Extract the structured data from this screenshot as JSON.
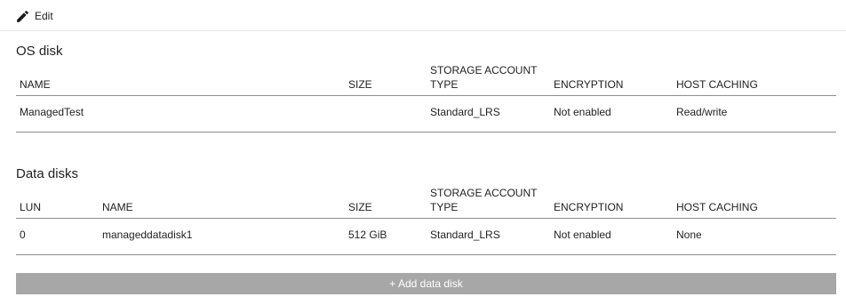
{
  "toolbar": {
    "edit_label": "Edit",
    "edit_icon": "pencil-icon"
  },
  "os_disk": {
    "title": "OS disk",
    "columns": {
      "name": "NAME",
      "size": "SIZE",
      "storage_line1": "STORAGE ACCOUNT",
      "storage_line2": "TYPE",
      "encryption": "ENCRYPTION",
      "host_caching": "HOST CACHING"
    },
    "row": {
      "name": "ManagedTest",
      "size": "",
      "storage_type": "Standard_LRS",
      "encryption": "Not enabled",
      "host_caching": "Read/write"
    }
  },
  "data_disks": {
    "title": "Data disks",
    "columns": {
      "lun": "LUN",
      "name": "NAME",
      "size": "SIZE",
      "storage_line1": "STORAGE ACCOUNT",
      "storage_line2": "TYPE",
      "encryption": "ENCRYPTION",
      "host_caching": "HOST CACHING"
    },
    "rows": [
      {
        "lun": "0",
        "name": "manageddatadisk1",
        "size": "512 GiB",
        "storage_type": "Standard_LRS",
        "encryption": "Not enabled",
        "host_caching": "None"
      }
    ],
    "add_button_label": "+ Add data disk"
  }
}
